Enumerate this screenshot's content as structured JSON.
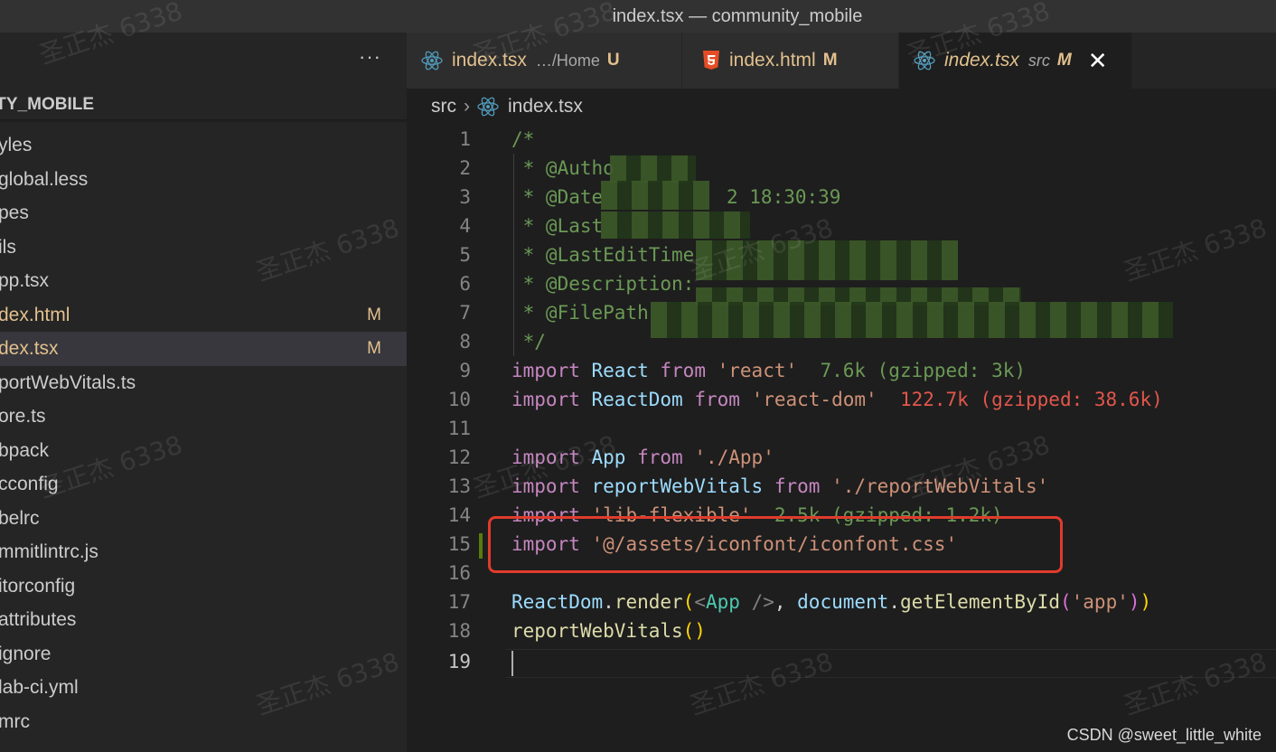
{
  "window": {
    "title": "index.tsx — community_mobile"
  },
  "sidebar": {
    "more_label": "···",
    "section_title": "ITY_MOBILE",
    "items": [
      {
        "label": "yles",
        "badge": "",
        "state": "normal"
      },
      {
        "label": "global.less",
        "badge": "",
        "state": "normal"
      },
      {
        "label": "pes",
        "badge": "",
        "state": "normal"
      },
      {
        "label": "ils",
        "badge": "",
        "state": "normal"
      },
      {
        "label": "pp.tsx",
        "badge": "",
        "state": "normal"
      },
      {
        "label": "dex.html",
        "badge": "M",
        "state": "modified"
      },
      {
        "label": "dex.tsx",
        "badge": "M",
        "state": "selected"
      },
      {
        "label": "portWebVitals.ts",
        "badge": "",
        "state": "normal"
      },
      {
        "label": "ore.ts",
        "badge": "",
        "state": "normal"
      },
      {
        "label": "bpack",
        "badge": "",
        "state": "normal"
      },
      {
        "label": "cconfig",
        "badge": "",
        "state": "normal"
      },
      {
        "label": "belrc",
        "badge": "",
        "state": "normal"
      },
      {
        "label": "mmitlintrc.js",
        "badge": "",
        "state": "normal"
      },
      {
        "label": "itorconfig",
        "badge": "",
        "state": "normal"
      },
      {
        "label": "attributes",
        "badge": "",
        "state": "normal"
      },
      {
        "label": "ignore",
        "badge": "",
        "state": "normal"
      },
      {
        "label": "lab-ci.yml",
        "badge": "",
        "state": "normal"
      },
      {
        "label": "mrc",
        "badge": "",
        "state": "normal"
      }
    ]
  },
  "tabs": [
    {
      "label": "index.tsx",
      "desc": "…/Home",
      "status": "U",
      "icon": "react-icon",
      "active": false
    },
    {
      "label": "index.html",
      "desc": "",
      "status": "M",
      "icon": "html5-icon",
      "active": false
    },
    {
      "label": "index.tsx",
      "desc": "src",
      "status": "M",
      "icon": "react-icon",
      "active": true,
      "close": "✕"
    }
  ],
  "breadcrumb": {
    "folder": "src",
    "separator": "›",
    "file": "index.tsx"
  },
  "code": {
    "line1": "/*",
    "line2": " * @Autho",
    "line3a": " * @Date",
    "line3b": "2 18:30:39",
    "line4": " * @Last",
    "line5": " * @LastEditTime",
    "line6": " * @Description:",
    "line7": " * @FilePath",
    "line8": " */",
    "l9_kw": "import",
    "l9_var": "React",
    "l9_from": "from",
    "l9_str": "'react'",
    "l9_size": "7.6k (gzipped: 3k)",
    "l10_kw": "import",
    "l10_var": "ReactDom",
    "l10_from": "from",
    "l10_str": "'react-dom'",
    "l10_size": "122.7k (gzipped: 38.6k)",
    "l12_kw": "import",
    "l12_var": "App",
    "l12_from": "from",
    "l12_str": "'./App'",
    "l13_kw": "import",
    "l13_var": "reportWebVitals",
    "l13_from": "from",
    "l13_str": "'./reportWebVitals'",
    "l14_kw": "import",
    "l14_str": "'lib-flexible'",
    "l14_size": "2.5k (gzipped: 1.2k)",
    "l15_kw": "import",
    "l15_str": "'@/assets/iconfont/iconfont.css'",
    "l17_obj": "ReactDom",
    "l17_dot": ".",
    "l17_fn": "render",
    "l17_p1": "(",
    "l17_lt": "<",
    "l17_tag": "App",
    "l17_close": " />",
    "l17_comma": ", ",
    "l17_doc": "document",
    "l17_dot2": ".",
    "l17_fn2": "getElementById",
    "l17_p2": "(",
    "l17_str": "'app'",
    "l17_p3": ")",
    "l17_p4": ")",
    "l18_fn": "reportWebVitals",
    "l18_p": "()"
  },
  "line_numbers": [
    "1",
    "2",
    "3",
    "4",
    "5",
    "6",
    "7",
    "8",
    "9",
    "10",
    "11",
    "12",
    "13",
    "14",
    "15",
    "16",
    "17",
    "18",
    "19"
  ],
  "watermark": "圣正杰 6338",
  "credit": "CSDN @sweet_little_white",
  "colors": {
    "modified": "#e2c08d",
    "accent_box": "#e03b2c",
    "gutter_added": "#587c0c"
  }
}
